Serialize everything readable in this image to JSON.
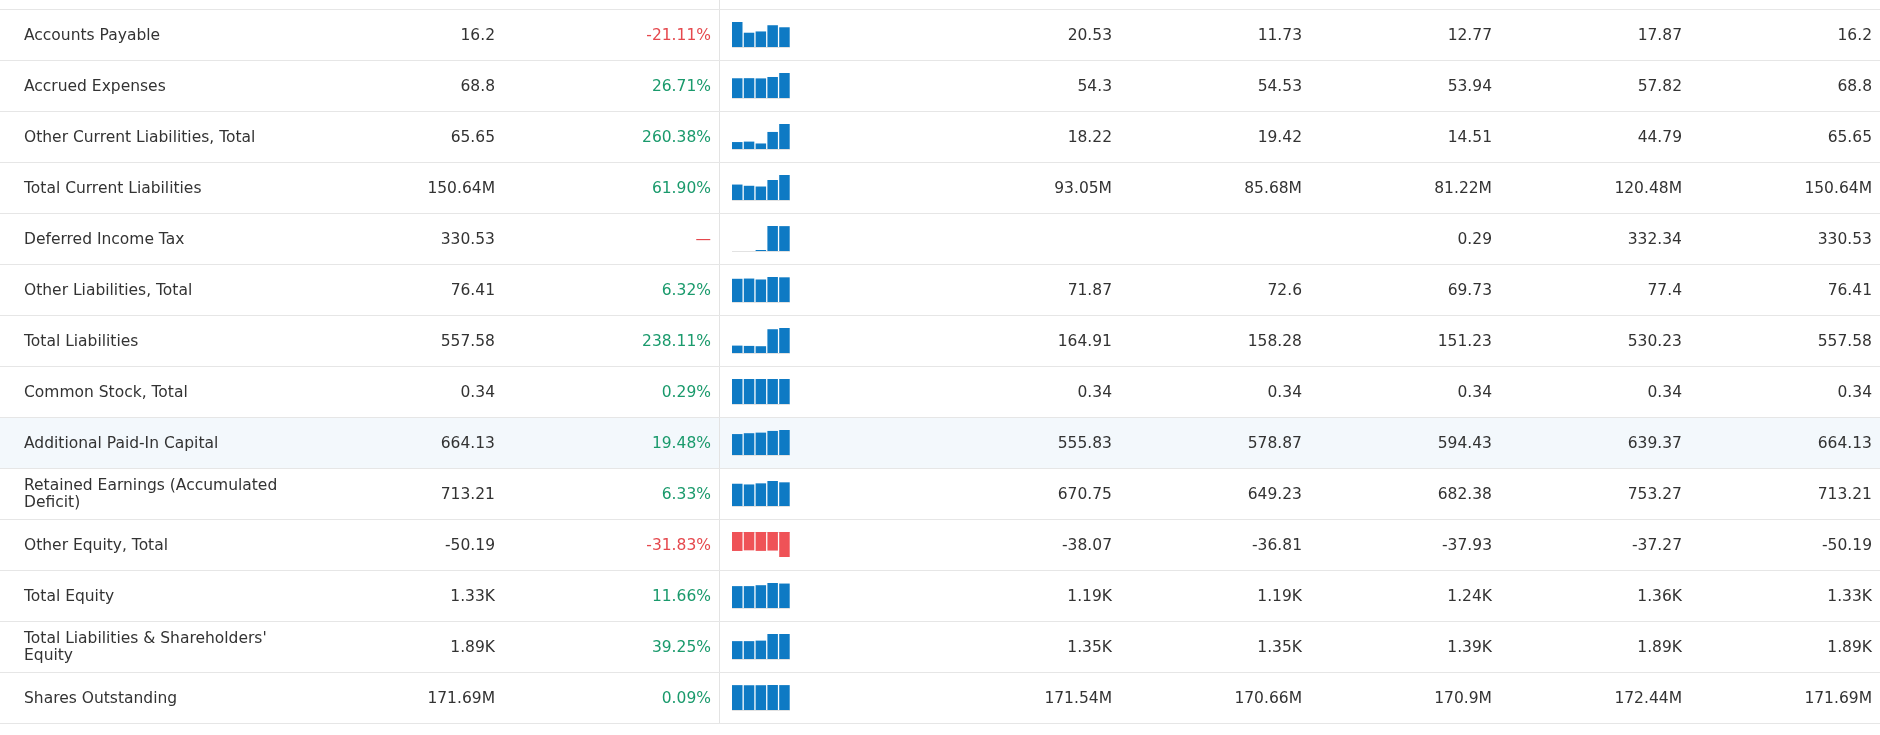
{
  "rows": [
    {
      "label": "Accounts Payable",
      "value": "16.2",
      "change": "-21.11%",
      "negative": true,
      "highlighted": false,
      "history": {
        "column_5": "20.53",
        "column_6": "11.73",
        "column_7": "12.77",
        "column_8": "17.87",
        "column_9": "16.2"
      }
    },
    {
      "label": "Accrued Expenses",
      "value": "68.8",
      "change": "26.71%",
      "negative": false,
      "highlighted": false,
      "history": {
        "column_5": "54.3",
        "column_6": "54.53",
        "column_7": "53.94",
        "column_8": "57.82",
        "column_9": "68.8"
      }
    },
    {
      "label": "Other Current Liabilities, Total",
      "value": "65.65",
      "change": "260.38%",
      "negative": false,
      "highlighted": false,
      "history": {
        "column_5": "18.22",
        "column_6": "19.42",
        "column_7": "14.51",
        "column_8": "44.79",
        "column_9": "65.65"
      }
    },
    {
      "label": "Total Current Liabilities",
      "value": "150.64M",
      "change": "61.90%",
      "negative": false,
      "highlighted": false,
      "history": {
        "column_5": "93.05M",
        "column_6": "85.68M",
        "column_7": "81.22M",
        "column_8": "120.48M",
        "column_9": "150.64M"
      }
    },
    {
      "label": "Deferred Income Tax",
      "value": "330.53",
      "change": "—",
      "negative": true,
      "highlighted": false,
      "history": {
        "column_7": "0.29",
        "column_8": "332.34",
        "column_9": "330.53"
      }
    },
    {
      "label": "Other Liabilities, Total",
      "value": "76.41",
      "change": "6.32%",
      "negative": false,
      "highlighted": false,
      "history": {
        "column_5": "71.87",
        "column_6": "72.6",
        "column_7": "69.73",
        "column_8": "77.4",
        "column_9": "76.41"
      }
    },
    {
      "label": "Total Liabilities",
      "value": "557.58",
      "change": "238.11%",
      "negative": false,
      "highlighted": false,
      "history": {
        "column_5": "164.91",
        "column_6": "158.28",
        "column_7": "151.23",
        "column_8": "530.23",
        "column_9": "557.58"
      }
    },
    {
      "label": "Common Stock, Total",
      "value": "0.34",
      "change": "0.29%",
      "negative": false,
      "highlighted": false,
      "history": {
        "column_5": "0.34",
        "column_6": "0.34",
        "column_7": "0.34",
        "column_8": "0.34",
        "column_9": "0.34"
      }
    },
    {
      "label": "Additional Paid-In Capital",
      "value": "664.13",
      "change": "19.48%",
      "negative": false,
      "highlighted": true,
      "history": {
        "column_5": "555.83",
        "column_6": "578.87",
        "column_7": "594.43",
        "column_8": "639.37",
        "column_9": "664.13"
      }
    },
    {
      "label": "Retained Earnings (Accumulated Deficit)",
      "value": "713.21",
      "change": "6.33%",
      "negative": false,
      "highlighted": false,
      "history": {
        "column_5": "670.75",
        "column_6": "649.23",
        "column_7": "682.38",
        "column_8": "753.27",
        "column_9": "713.21"
      }
    },
    {
      "label": "Other Equity, Total",
      "value": "-50.19",
      "change": "-31.83%",
      "negative": true,
      "highlighted": false,
      "history": {
        "column_5": "-38.07",
        "column_6": "-36.81",
        "column_7": "-37.93",
        "column_8": "-37.27",
        "column_9": "-50.19"
      }
    },
    {
      "label": "Total Equity",
      "value": "1.33K",
      "change": "11.66%",
      "negative": false,
      "highlighted": false,
      "history": {
        "column_5": "1.19K",
        "column_6": "1.19K",
        "column_7": "1.24K",
        "column_8": "1.36K",
        "column_9": "1.33K"
      }
    },
    {
      "label": "Total Liabilities & Shareholders' Equity",
      "value": "1.89K",
      "change": "39.25%",
      "negative": false,
      "highlighted": false,
      "history": {
        "column_5": "1.35K",
        "column_6": "1.35K",
        "column_7": "1.39K",
        "column_8": "1.89K",
        "column_9": "1.89K"
      }
    },
    {
      "label": "Shares Outstanding",
      "value": "171.69M",
      "change": "0.09%",
      "negative": false,
      "highlighted": false,
      "history": {
        "column_5": "171.54M",
        "column_6": "170.66M",
        "column_7": "170.9M",
        "column_8": "172.44M",
        "column_9": "171.69M"
      }
    }
  ]
}
